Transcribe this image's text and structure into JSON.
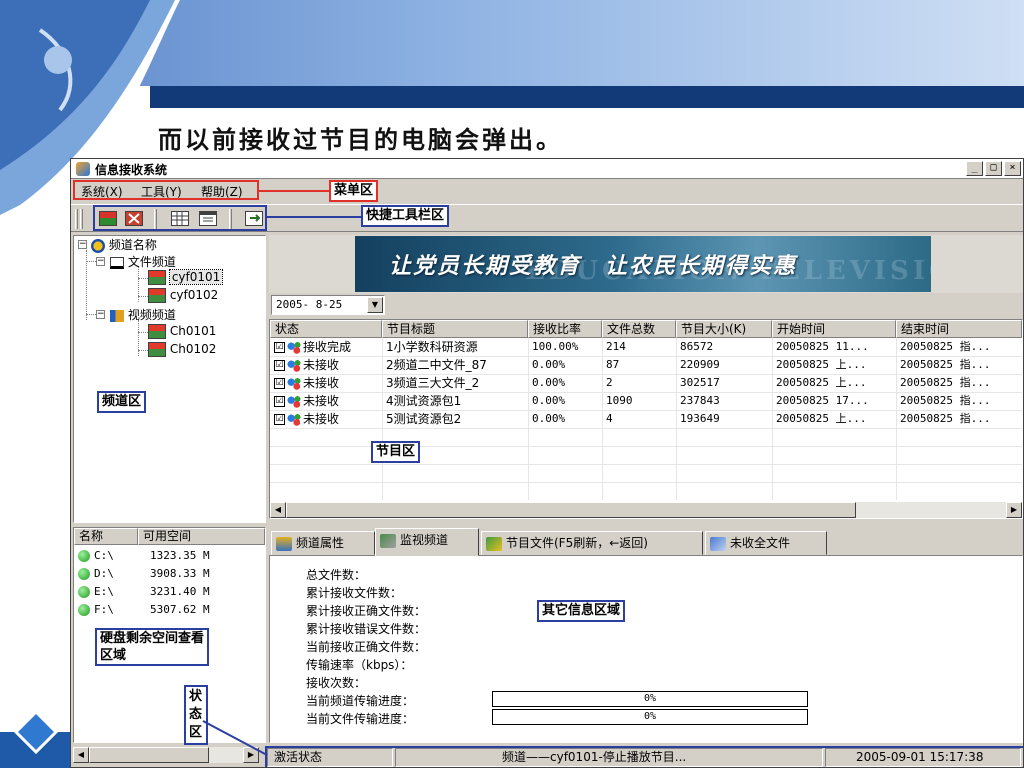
{
  "slide": {
    "title": "而以前接收过节目的电脑会弹出。"
  },
  "window": {
    "title": "信息接收系统",
    "controls": {
      "minimize": "_",
      "maximize": "□",
      "close": "×"
    },
    "menu": [
      "系统(X)",
      "工具(Y)",
      "帮助(Z)"
    ]
  },
  "tree": {
    "root": "频道名称",
    "file_channel": "文件频道",
    "file_children": [
      "cyf0101",
      "cyf0102"
    ],
    "video_channel": "视频频道",
    "video_children": [
      "Ch0101",
      "Ch0102"
    ]
  },
  "banner": {
    "text": "让党员长期受教育　让农民长期得实惠",
    "ghost": "EDUCATION TELEVISION"
  },
  "date_filter": {
    "value": "2005- 8-25"
  },
  "programs": {
    "columns": [
      "状态",
      "节目标题",
      "接收比率",
      "文件总数",
      "节目大小(K)",
      "开始时间",
      "结束时间"
    ],
    "rows": [
      {
        "check": "☑",
        "status": "接收完成",
        "title": "1小学数科研资源",
        "ratio": "100.00%",
        "files": "214",
        "size": "86572",
        "start": "20050825 11...",
        "end": "20050825 指..."
      },
      {
        "check": "☑",
        "status": "未接收",
        "title": "2频道二中文件_87",
        "ratio": "0.00%",
        "files": "87",
        "size": "220909",
        "start": "20050825 上...",
        "end": "20050825 指..."
      },
      {
        "check": "☑",
        "status": "未接收",
        "title": "3频道三大文件_2",
        "ratio": "0.00%",
        "files": "2",
        "size": "302517",
        "start": "20050825 上...",
        "end": "20050825 指..."
      },
      {
        "check": "☑",
        "status": "未接收",
        "title": "4测试资源包1",
        "ratio": "0.00%",
        "files": "1090",
        "size": "237843",
        "start": "20050825 17...",
        "end": "20050825 指..."
      },
      {
        "check": "☑",
        "status": "未接收",
        "title": "5测试资源包2",
        "ratio": "0.00%",
        "files": "4",
        "size": "193649",
        "start": "20050825 上...",
        "end": "20050825 指..."
      }
    ]
  },
  "drives": {
    "columns": [
      "名称",
      "可用空间"
    ],
    "rows": [
      {
        "name": "C:\\",
        "free": "1323.35 M"
      },
      {
        "name": "D:\\",
        "free": "3908.33 M"
      },
      {
        "name": "E:\\",
        "free": "3231.40 M"
      },
      {
        "name": "F:\\",
        "free": "5307.62 M"
      }
    ]
  },
  "tabs": [
    "频道属性",
    "监视频道",
    "节目文件(F5刷新，←返回)",
    "未收全文件"
  ],
  "info": {
    "labels": [
      "总文件数：",
      "累计接收文件数：",
      "累计接收正确文件数：",
      "累计接收错误文件数：",
      "当前接收正确文件数：",
      "传输速率（kbps）：",
      "接收次数：",
      "当前频道传输进度：",
      "当前文件传输进度："
    ],
    "channel_progress": {
      "text": "0%",
      "fraction": 0
    },
    "file_progress": {
      "text": "0%",
      "fraction": 0
    }
  },
  "status_bar": {
    "state": "激活状态",
    "message": "频道——cyf0101-停止播放节目...",
    "time": "2005-09-01 15:17:38"
  },
  "annotations": {
    "menu_area": "菜单区",
    "toolbar_area": "快捷工具栏区",
    "channel_area": "频道区",
    "program_area": "节目区",
    "info_area": "其它信息区域",
    "disk_area": "硬盘剩余空间查看区域",
    "status_area": "状态区"
  },
  "colors": {
    "annotation_red": "#e0302a",
    "annotation_blue": "#2a3fa0",
    "window_face": "#d4d0c8"
  }
}
